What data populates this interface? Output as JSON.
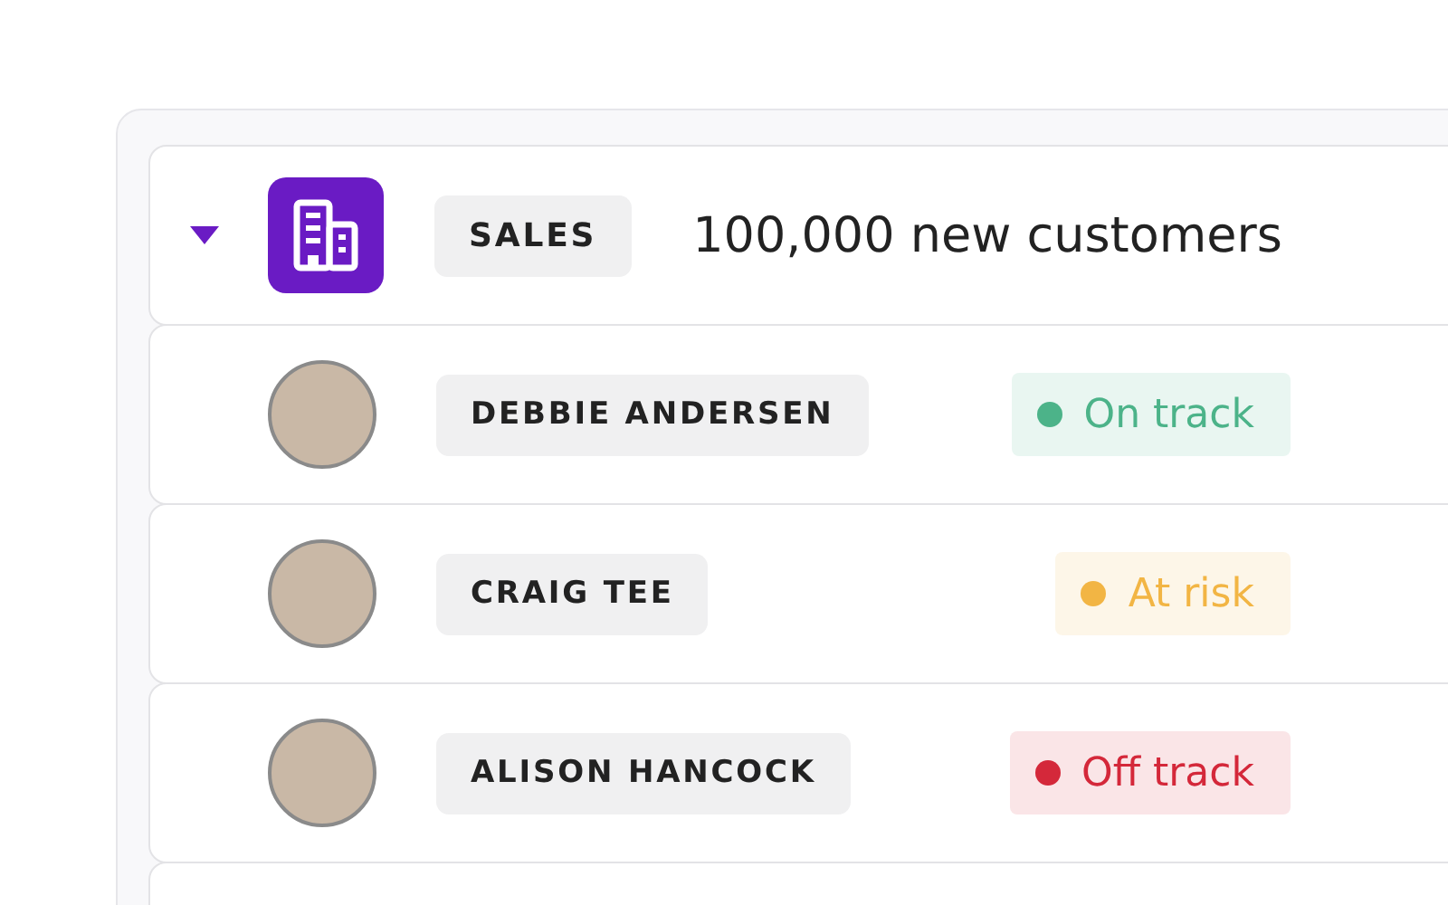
{
  "goal": {
    "expanded": true,
    "tag": "SALES",
    "title": "100,000 new customers"
  },
  "owners": [
    {
      "name": "DEBBIE ANDERSEN",
      "status": "On track",
      "color": "#4cb389"
    },
    {
      "name": "CRAIG TEE",
      "status": "At risk",
      "color": "#f2b544"
    },
    {
      "name": "ALISON HANCOCK",
      "status": "Off track",
      "color": "#d4283a"
    }
  ]
}
